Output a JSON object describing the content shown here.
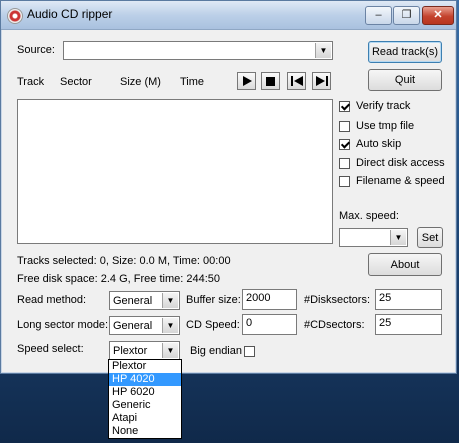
{
  "window": {
    "title": "Audio CD ripper",
    "controls": {
      "minimize": "–",
      "maximize": "❐",
      "close": "✕"
    }
  },
  "source": {
    "label": "Source:",
    "value": ""
  },
  "buttons": {
    "read_tracks": "Read track(s)",
    "quit": "Quit",
    "about": "About",
    "set": "Set"
  },
  "track_headers": [
    "Track",
    "Sector",
    "Size (M)",
    "Time"
  ],
  "transport": [
    "play-icon",
    "stop-icon",
    "skip-back-icon",
    "skip-forward-icon"
  ],
  "options": [
    {
      "label": "Verify track",
      "checked": true
    },
    {
      "label": "Use tmp file",
      "checked": false
    },
    {
      "label": "Auto skip",
      "checked": true
    },
    {
      "label": "Direct disk access",
      "checked": false
    },
    {
      "label": "Filename & speed",
      "checked": false
    }
  ],
  "max_speed": {
    "label": "Max. speed:",
    "value": ""
  },
  "status": {
    "tracks_selected": "Tracks selected: 0, Size: 0.0 M, Time: 00:00",
    "free_disk": "Free disk space: 2.4 G, Free time: 244:50"
  },
  "settings": {
    "read_method_label": "Read method:",
    "read_method_value": "General",
    "long_sector_label": "Long sector mode:",
    "long_sector_value": "General",
    "speed_select_label": "Speed select:",
    "speed_select_value": "Plextor",
    "buffer_size_label": "Buffer size:",
    "buffer_size_value": "2000",
    "cd_speed_label": "CD Speed:",
    "cd_speed_value": "0",
    "disk_sectors_label": "#Disksectors:",
    "disk_sectors_value": "25",
    "cd_sectors_label": "#CDsectors:",
    "cd_sectors_value": "25",
    "big_endian_label": "Big endian",
    "big_endian_checked": false
  },
  "speed_dropdown": {
    "options": [
      "Plextor",
      "HP 4020",
      "HP 6020",
      "Generic",
      "Atapi",
      "None"
    ],
    "selected_index": 1
  },
  "colors": {
    "selection": "#3399ff",
    "window_bg": "#f0f0f0"
  }
}
